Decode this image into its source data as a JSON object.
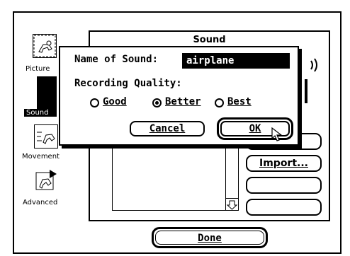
{
  "sidebar": {
    "items": [
      {
        "label": "Picture"
      },
      {
        "label": "Sound"
      },
      {
        "label": "Movement"
      },
      {
        "label": "Advanced"
      }
    ]
  },
  "panel": {
    "title": "Sound",
    "import_label": "Import..."
  },
  "dialog": {
    "name_label": "Name of Sound:",
    "name_value": "airplane",
    "quality_label": "Recording Quality:",
    "options": [
      "Good",
      "Better",
      "Best"
    ],
    "selected": "Better",
    "cancel_label": "Cancel",
    "ok_label": "OK"
  },
  "footer": {
    "done_label": "Done"
  }
}
